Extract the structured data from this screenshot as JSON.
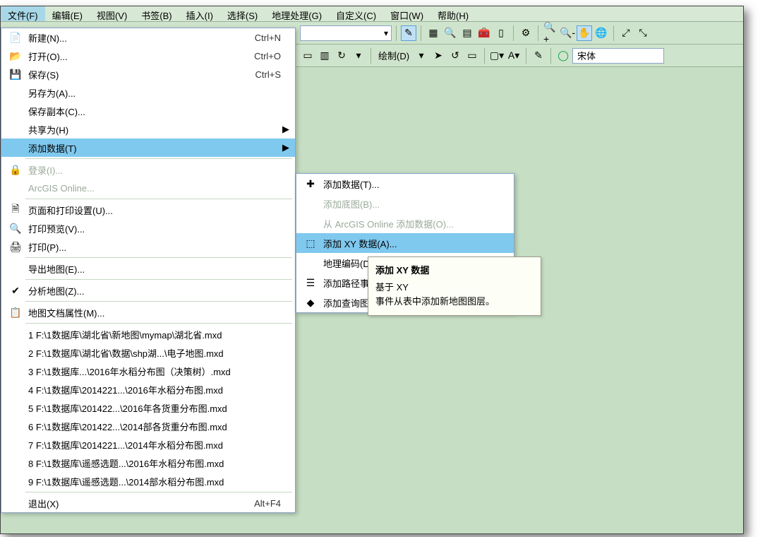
{
  "menubar": [
    {
      "label": "文件(F)"
    },
    {
      "label": "编辑(E)"
    },
    {
      "label": "视图(V)"
    },
    {
      "label": "书签(B)"
    },
    {
      "label": "插入(I)"
    },
    {
      "label": "选择(S)"
    },
    {
      "label": "地理处理(G)"
    },
    {
      "label": "自定义(C)"
    },
    {
      "label": "窗口(W)"
    },
    {
      "label": "帮助(H)"
    }
  ],
  "toolbar2": {
    "draw_label": "绘制(D)",
    "font_label": "宋体"
  },
  "file_menu": {
    "new": {
      "icon": "📄",
      "label": "新建(N)...",
      "short": "Ctrl+N"
    },
    "open": {
      "icon": "📂",
      "label": "打开(O)...",
      "short": "Ctrl+O"
    },
    "save": {
      "icon": "💾",
      "label": "保存(S)",
      "short": "Ctrl+S"
    },
    "saveas": {
      "icon": "",
      "label": "另存为(A)..."
    },
    "savecopy": {
      "icon": "",
      "label": "保存副本(C)..."
    },
    "share": {
      "icon": "",
      "label": "共享为(H)",
      "arrow": "▶"
    },
    "adddata": {
      "icon": "",
      "label": "添加数据(T)",
      "arrow": "▶",
      "highlight": true
    },
    "login": {
      "icon": "🔒",
      "label": "登录(I)...",
      "disabled": true
    },
    "arcgis": {
      "icon": "",
      "label": "ArcGIS Online...",
      "disabled": true
    },
    "pagesetup": {
      "icon": "🗎",
      "label": "页面和打印设置(U)..."
    },
    "preview": {
      "icon": "🔍",
      "label": "打印预览(V)..."
    },
    "print": {
      "icon": "🖨",
      "label": "打印(P)..."
    },
    "exportmap": {
      "icon": "",
      "label": "导出地图(E)..."
    },
    "analyze": {
      "icon": "✔",
      "label": "分析地图(Z)..."
    },
    "docprops": {
      "icon": "📋",
      "label": "地图文档属性(M)..."
    },
    "recent": [
      "1 F:\\1数据库\\湖北省\\新地图\\mymap\\湖北省.mxd",
      "2 F:\\1数据库\\湖北省\\数据\\shp湖...\\电子地图.mxd",
      "3 F:\\1数据库...\\2016年水稻分布图（决策树）.mxd",
      "4 F:\\1数据库\\2014221...\\2016年水稻分布图.mxd",
      "5 F:\\1数据库\\201422...\\2016年各货重分布图.mxd",
      "6 F:\\1数据库\\201422...\\2014部各货重分布图.mxd",
      "7 F:\\1数据库\\2014221...\\2014年水稻分布图.mxd",
      "8 F:\\1数据库\\遥感选题...\\2016年水稻分布图.mxd",
      "9 F:\\1数据库\\遥感选题...\\2014部水稻分布图.mxd"
    ],
    "exit": {
      "label": "退出(X)",
      "short": "Alt+F4"
    }
  },
  "submenu": [
    {
      "icon": "✚",
      "label": "添加数据(T)..."
    },
    {
      "icon": "",
      "label": "添加底图(B)...",
      "disabled": true
    },
    {
      "icon": "",
      "label": "从 ArcGIS Online 添加数据(O)...",
      "disabled": true
    },
    {
      "icon": "⬚",
      "label": "添加 XY 数据(A)...",
      "highlight": true
    },
    {
      "icon": "",
      "label": "地理编码(D)"
    },
    {
      "icon": "☰",
      "label": "添加路径事件(V)..."
    },
    {
      "icon": "◆",
      "label": "添加查询图层(L)..."
    }
  ],
  "tooltip": {
    "title": "添加 XY 数据",
    "line1": "基于 XY",
    "line2": "事件从表中添加新地图图层。"
  }
}
